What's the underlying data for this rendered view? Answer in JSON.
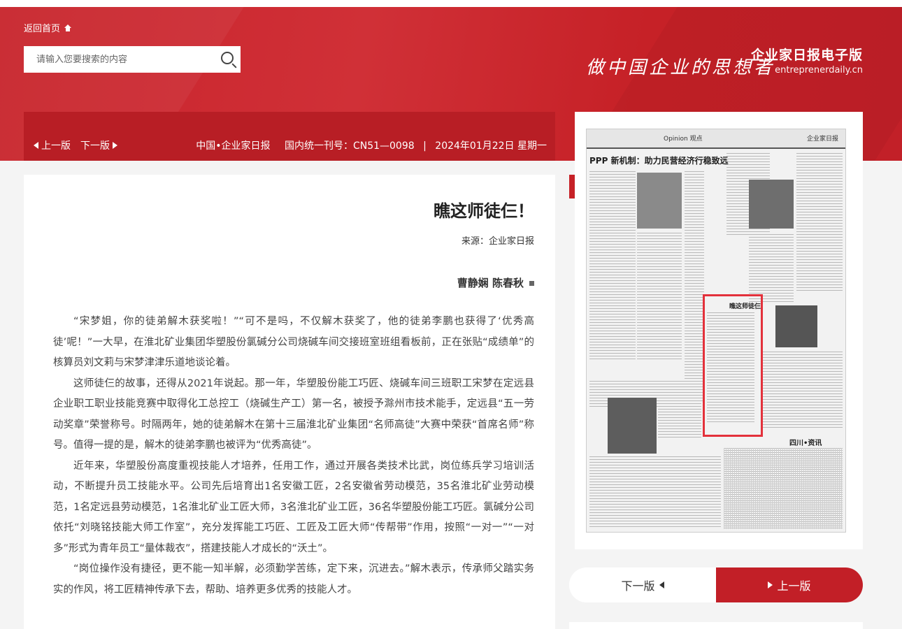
{
  "header": {
    "home_label": "返回首页",
    "search_placeholder": "请输入您要搜索的内容",
    "brand_name": "企业家日报电子版",
    "brand_url": "entreprenerdaily.cn",
    "slogan": "做中国企业的思想者"
  },
  "infobar": {
    "date": "2024年01月22日 星期一",
    "cn": "国内统一刊号：CN51—0098",
    "publisher": "中国•企业家日报",
    "prev_label": "上一版",
    "next_label": "下一版"
  },
  "article": {
    "title": "瞧这师徒仨！",
    "source": "来源：企业家日报",
    "author": "曹静娴 陈春秋",
    "paragraphs": [
      "“宋梦姐，你的徒弟解木获奖啦！”“可不是吗，不仅解木获奖了，他的徒弟李鹏也获得了‘优秀高徒’呢！”一大早，在淮北矿业集团华塑股份氯碱分公司烧碱车间交接班室班组看板前，正在张贴“成绩单”的核算员刘文莉与宋梦津津乐道地谈论着。",
      "这师徒仨的故事，还得从2021年说起。那一年，华塑股份能工巧匠、烧碱车间三班职工宋梦在定远县企业职工职业技能竞赛中取得化工总控工（烧碱生产工）第一名，被授予滁州市技术能手，定远县“五一劳动奖章”荣誉称号。时隔两年，她的徒弟解木在第十三届淮北矿业集团“名师高徒”大赛中荣获“首席名师”称号。值得一提的是，解木的徒弟李鹏也被评为“优秀高徒”。",
      "近年来，华塑股份高度重视技能人才培养，任用工作，通过开展各类技术比武，岗位练兵学习培训活动，不断提升员工技能水平。公司先后培育出1名安徽工匠，2名安徽省劳动模范，35名淮北矿业劳动模范，1名定远县劳动模范，1名淮北矿业工匠大师，3名淮北矿业工匠，36名华塑股份能工巧匠。氯碱分公司依托“刘晓铭技能大师工作室”，充分发挥能工巧匠、工匠及工匠大师“传帮带”作用，按照“一对一”“一对多”形式为青年员工“量体裁衣”，搭建技能人才成长的“沃土”。",
      "“岗位操作没有捷径，更不能一知半解，必须勤学苦练，定下来，沉进去。”解木表示，传承师父踏实务实的作风，将工匠精神传承下去，帮助、培养更多优秀的技能人才。"
    ]
  },
  "side": {
    "paper_header_left": "企业家日报",
    "paper_header_right": "Opinion 观点",
    "headline_1": "PPP 新机制：助力民营经济行稳致远",
    "headline_2": "瞧这师徒仨！",
    "headline_3": "四川•资讯",
    "prev_label": "上一版",
    "next_label": "下一版"
  },
  "colors": {
    "brand_red": "#c62127",
    "infobar_red": "#b81e25",
    "highlight_red": "#e3313b"
  }
}
